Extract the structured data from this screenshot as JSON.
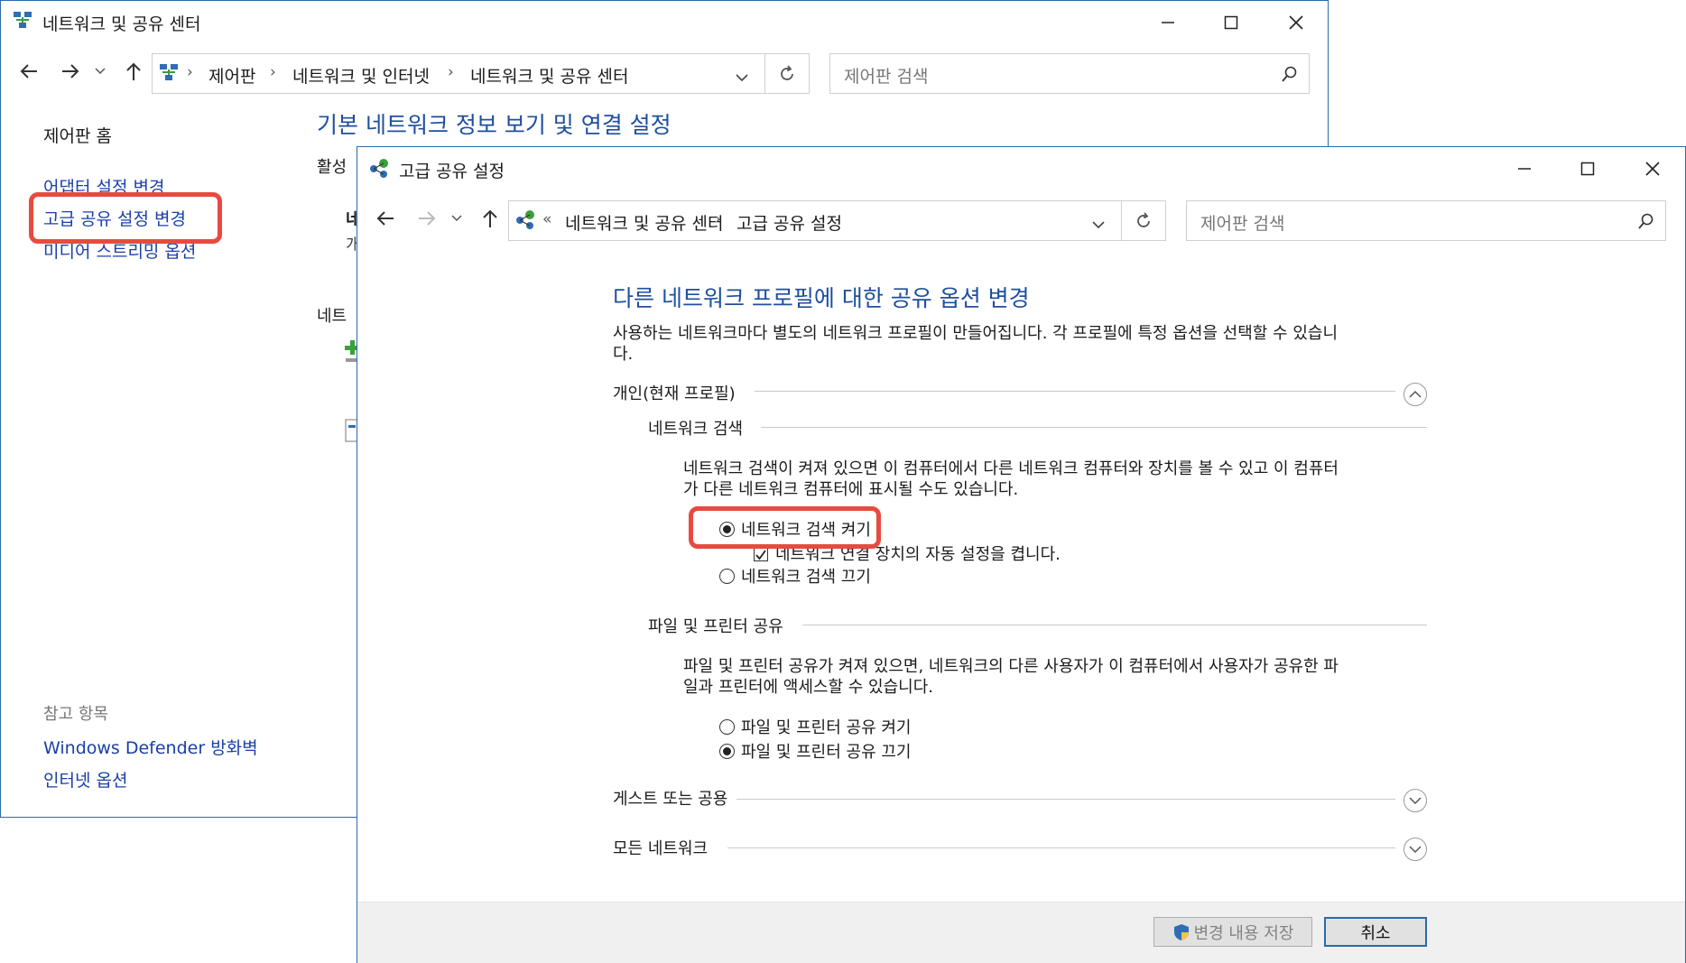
{
  "back_window": {
    "title": "네트워크 및 공유 센터",
    "breadcrumbs": [
      "제어판",
      "네트워크 및 인터넷",
      "네트워크 및 공유 센터"
    ],
    "search_placeholder": "제어판 검색",
    "sidebar": {
      "home": "제어판 홈",
      "adapter": "어댑터 설정 변경",
      "advanced": "고급 공유 설정 변경",
      "media": "미디어 스트리밍 옵션"
    },
    "see_also": {
      "heading": "참고 항목",
      "items": [
        "Windows Defender 방화벽",
        "인터넷 옵션"
      ]
    },
    "main_title": "기본 네트워크 정보 보기 및 연결 설정",
    "active_label": "활성",
    "network_label": "네트",
    "frag1": "네",
    "frag2": "개"
  },
  "front_window": {
    "title": "고급 공유 설정",
    "breadcrumb_prefix": "«",
    "breadcrumbs": [
      "네트워크 및 공유 센터",
      "고급 공유 설정"
    ],
    "search_placeholder": "제어판 검색",
    "heading": "다른 네트워크 프로필에 대한 공유 옵션 변경",
    "description": [
      "사용하는 네트워크마다 별도의 네트워크 프로필이 만들어집니다. 각 프로필에 특정 옵션을 선택할 수 있습니",
      "다."
    ],
    "profile_private": "개인(현재 프로필)",
    "network_discovery": {
      "label": "네트워크 검색",
      "description": [
        "네트워크 검색이 켜져 있으면 이 컴퓨터에서 다른 네트워크 컴퓨터와 장치를 볼 수 있고 이 컴퓨터",
        "가 다른 네트워크 컴퓨터에 표시될 수도 있습니다."
      ],
      "on": "네트워크 검색 켜기",
      "auto_setup": "네트워크 연결 장치의 자동 설정을 켭니다.",
      "off": "네트워크 검색 끄기",
      "selected": "on",
      "auto_setup_checked": true
    },
    "file_sharing": {
      "label": "파일 및 프린터 공유",
      "description": [
        "파일 및 프린터 공유가 켜져 있으면, 네트워크의 다른 사용자가 이 컴퓨터에서 사용자가 공유한 파",
        "일과 프린터에 액세스할 수 있습니다."
      ],
      "on": "파일 및 프린터 공유 켜기",
      "off": "파일 및 프린터 공유 끄기",
      "selected": "off"
    },
    "profile_guest": "게스트 또는 공용",
    "profile_all": "모든 네트워크",
    "save_button": "변경 내용 저장",
    "cancel_button": "취소"
  },
  "colors": {
    "link": "#1a3fa8",
    "heading": "#1e4f9e",
    "highlight": "#e84a3f",
    "footer": "#f0f0f0"
  }
}
